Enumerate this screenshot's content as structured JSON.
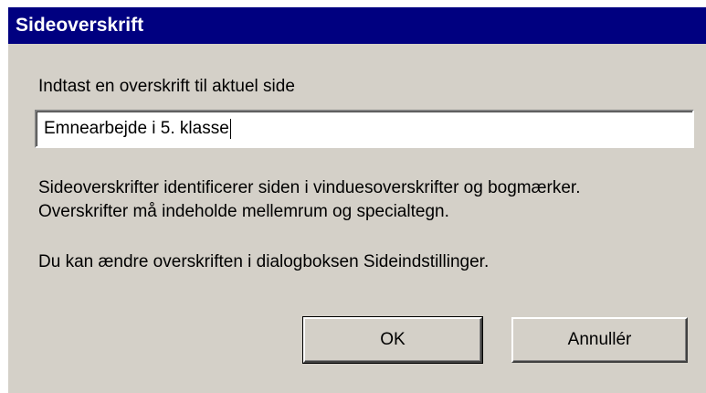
{
  "dialog": {
    "title": "Sideoverskrift",
    "prompt": "Indtast en overskrift til aktuel side",
    "input": {
      "value": "Emnearbejde i 5. klasse"
    },
    "description": [
      "Sideoverskrifter identificerer siden i vinduesoverskrifter og bogmærker.",
      "Overskrifter må indeholde mellemrum og specialtegn."
    ],
    "hint": "Du kan ændre overskriften i dialogboksen Sideindstillinger.",
    "buttons": {
      "ok_label": "OK",
      "cancel_label": "Annullér"
    }
  },
  "colors": {
    "titlebar": "#000080",
    "dialog_background": "#d4d0c8"
  }
}
